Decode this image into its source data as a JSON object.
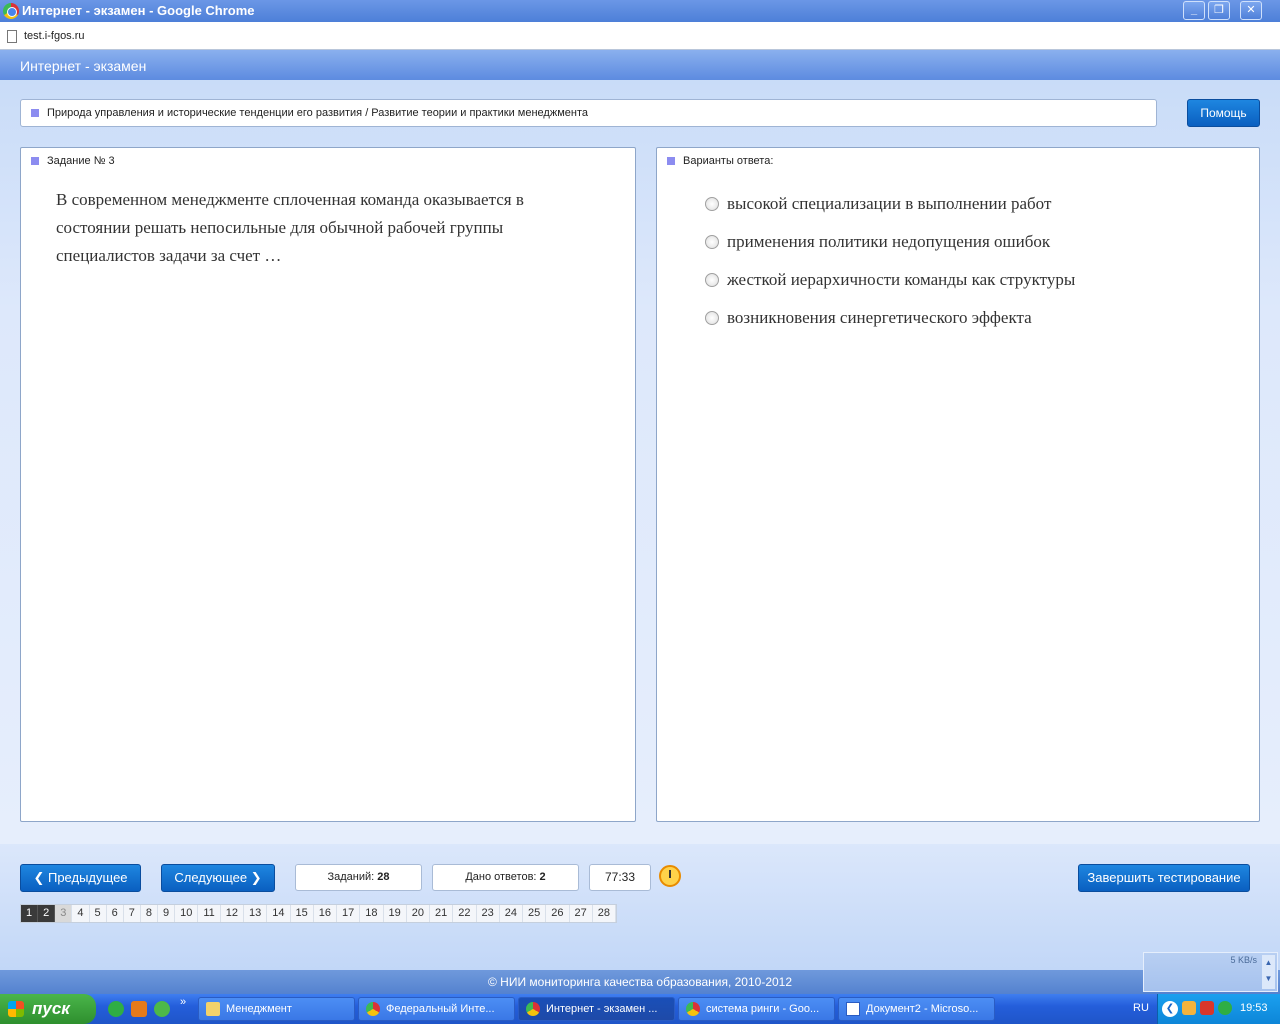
{
  "window": {
    "title": "Интернет - экзамен - Google Chrome",
    "controls": {
      "minimize": "_",
      "maximize": "❐",
      "close": "✕"
    }
  },
  "address_bar": {
    "url": "test.i-fgos.ru"
  },
  "app": {
    "title": "Интернет - экзамен"
  },
  "breadcrumb": {
    "text": "Природа управления и исторические тенденции его развития / Развитие теории и практики менеджмента"
  },
  "help_button": {
    "label": "Помощь"
  },
  "question_panel": {
    "title": "Задание № 3",
    "text": "В современном менеджменте сплоченная команда оказывается в состоянии решать непосильные для обычной рабочей группы специалистов задачи за счет …"
  },
  "answer_panel": {
    "title": "Варианты ответа:",
    "options": [
      {
        "label": "высокой специализации в выполнении работ"
      },
      {
        "label": "применения политики недопущения ошибок"
      },
      {
        "label": "жесткой иерархичности команды как структуры"
      },
      {
        "label": "возникновения синергетического эффекта"
      }
    ]
  },
  "navigation": {
    "prev_label": "Предыдущее",
    "next_label": "Следующее",
    "tasks_label": "Заданий:",
    "tasks_count": "28",
    "answers_label": "Дано ответов:",
    "answers_count": "2",
    "timer": "77:33",
    "finish_label": "Завершить тестирование"
  },
  "pager": {
    "pages": [
      "1",
      "2",
      "3",
      "4",
      "5",
      "6",
      "7",
      "8",
      "9",
      "10",
      "11",
      "12",
      "13",
      "14",
      "15",
      "16",
      "17",
      "18",
      "19",
      "20",
      "21",
      "22",
      "23",
      "24",
      "25",
      "26",
      "27",
      "28"
    ],
    "answered": [
      "1",
      "2"
    ],
    "current": "3"
  },
  "footer": {
    "copyright": "© НИИ мониторинга качества образования, 2010-2012"
  },
  "net_widget": {
    "speed": "5 KB/s"
  },
  "taskbar": {
    "start_label": "пуск",
    "more": "»",
    "tasks": [
      {
        "label": "Менеджмент",
        "icon": "folder-icon"
      },
      {
        "label": "Федеральный Инте...",
        "icon": "chrome-icon"
      },
      {
        "label": "Интернет - экзамен ...",
        "icon": "chrome-icon"
      },
      {
        "label": "система ринги - Goo...",
        "icon": "chrome-icon"
      },
      {
        "label": "Документ2 - Microso...",
        "icon": "word-icon"
      }
    ],
    "lang": "RU",
    "clock": "19:53"
  }
}
